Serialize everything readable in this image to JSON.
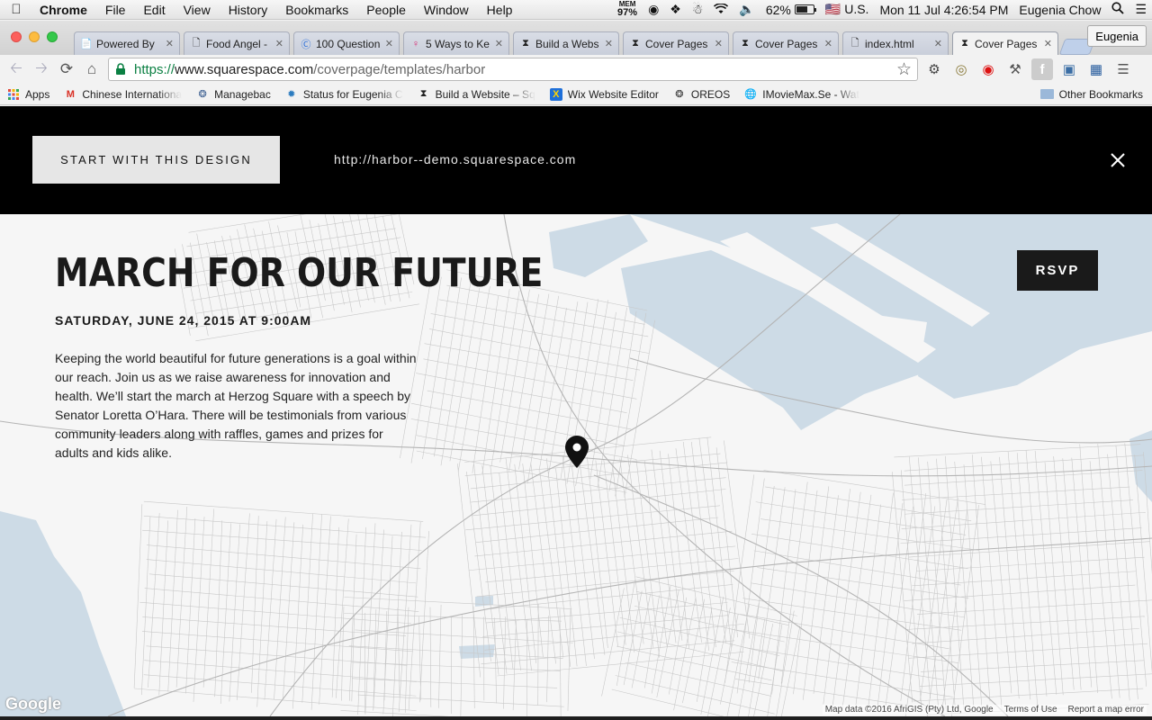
{
  "menubar": {
    "app": "Chrome",
    "items": [
      "File",
      "Edit",
      "View",
      "History",
      "Bookmarks",
      "People",
      "Window",
      "Help"
    ],
    "mem_label": "MEM",
    "mem_value": "97%",
    "battery": "62%",
    "battery_level": 0.62,
    "input_source": "U.S.",
    "clock": "Mon 11 Jul  4:26:54 PM",
    "user": "Eugenia Chow"
  },
  "tabs": [
    {
      "title": "Powered By ",
      "icon": "document-icon"
    },
    {
      "title": "Food Angel -",
      "icon": "page-icon"
    },
    {
      "title": "100 Question",
      "icon": "q-logo-icon"
    },
    {
      "title": "5 Ways to Ke",
      "icon": "female-symbol-icon"
    },
    {
      "title": "Build a Webs",
      "icon": "squarespace-icon"
    },
    {
      "title": "Cover Pages",
      "icon": "squarespace-icon"
    },
    {
      "title": "Cover Pages",
      "icon": "squarespace-icon"
    },
    {
      "title": "index.html",
      "icon": "page-icon"
    },
    {
      "title": "Cover Pages",
      "icon": "squarespace-icon",
      "active": true
    }
  ],
  "profile_button": "Eugenia",
  "address": {
    "scheme": "https://",
    "host": "www.squarespace.com",
    "path": "/coverpage/templates/harbor"
  },
  "bookmarks": [
    {
      "label": "Apps",
      "icon": "apps-grid-icon"
    },
    {
      "label": "Chinese Internationa",
      "icon": "gmail-icon"
    },
    {
      "label": "Managebac",
      "icon": "managebac-icon"
    },
    {
      "label": "Status for Eugenia C",
      "icon": "status-icon"
    },
    {
      "label": "Build a Website – Sq",
      "icon": "squarespace-icon"
    },
    {
      "label": "Wix Website Editor",
      "icon": "wix-icon"
    },
    {
      "label": "OREOS",
      "icon": "oreos-icon"
    },
    {
      "label": "IMovieMax.Se - Wat",
      "icon": "globe-icon"
    }
  ],
  "other_bookmarks": "Other Bookmarks",
  "preview": {
    "start_button": "START WITH THIS DESIGN",
    "demo_url": "http://harbor--demo.squarespace.com"
  },
  "page": {
    "headline": "MARCH FOR OUR FUTURE",
    "date": "SATURDAY, JUNE 24, 2015 AT 9:00AM",
    "description": "Keeping the world beautiful for future generations is a goal within our reach. Join us as we raise awareness for innovation and health. We’ll start the march at Herzog Square with a speech by Senator Loretta O’Hara. There will be testimonials from various community leaders along with raffles, games and prizes for adults and kids alike.",
    "rsvp": "RSVP"
  },
  "map": {
    "google": "Google",
    "attribution": "Map data ©2016 AfriGIS (Pty) Ltd, Google",
    "terms": "Terms of Use",
    "report": "Report a map error",
    "water_color": "#cddbe6",
    "land_color": "#f6f6f6"
  }
}
